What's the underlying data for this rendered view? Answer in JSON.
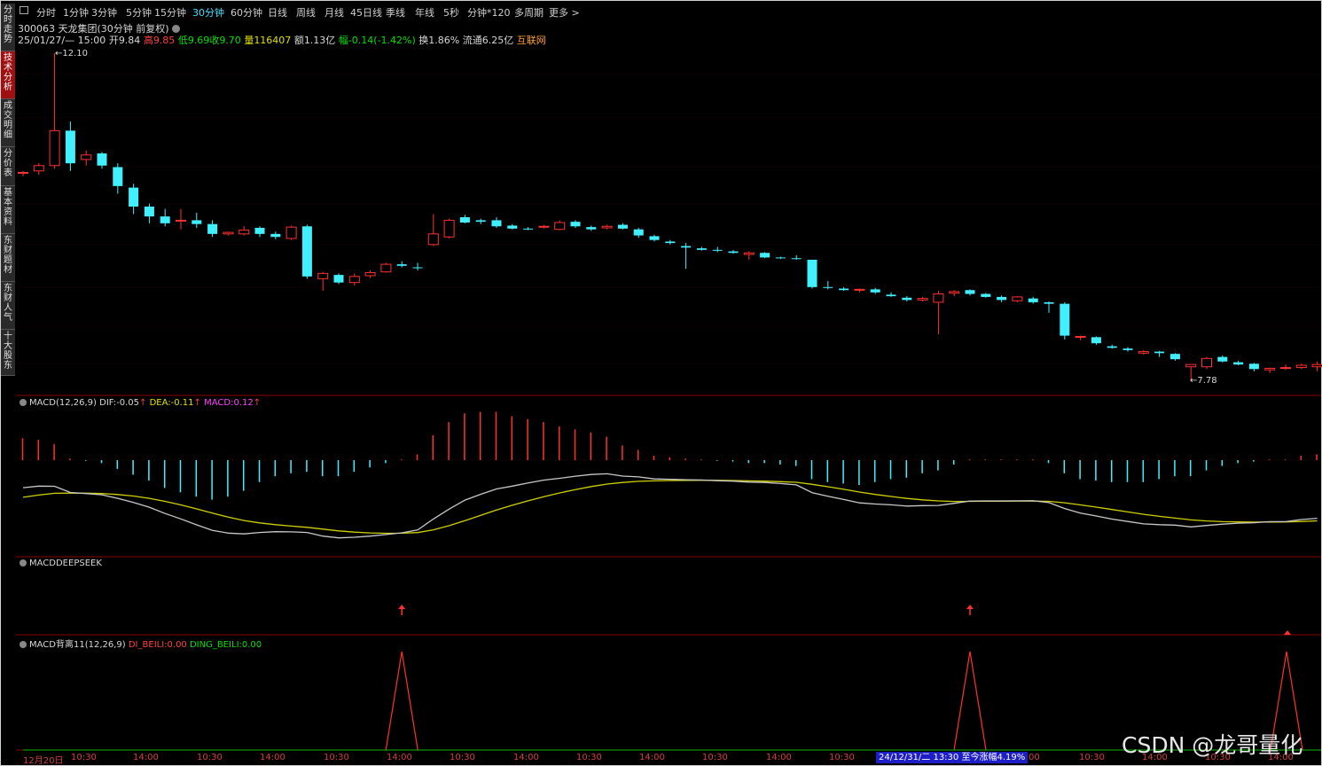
{
  "side_tabs": [
    "分时走势",
    "技术分析",
    "成交明细",
    "分价表",
    "基本资料",
    "东财题材",
    "东财人气",
    "十大股东"
  ],
  "active_side_tab": 1,
  "period_tabs": [
    "分时",
    "1分钟",
    "3分钟",
    "5分钟",
    "15分钟",
    "30分钟",
    "60分钟",
    "日线",
    "周线",
    "月线",
    "45日线",
    "季线",
    "年线",
    "5秒",
    "分钟*120",
    "多周期",
    "更多 >"
  ],
  "active_period_tab": 5,
  "stock": {
    "code_name": "300063 天龙集团",
    "adjust": "(30分钟 前复权)"
  },
  "quote": {
    "datetime": "25/01/27/— 15:00",
    "open_label": "开",
    "open": "9.84",
    "high_label": "高",
    "high": "9.85",
    "low_label": "低",
    "low": "9.69",
    "close_label": "收",
    "close": "9.70",
    "vol_label": "量",
    "vol": "116407",
    "amount_label": "额",
    "amount": "1.13亿",
    "change_label": "幅",
    "change": "-0.14(-1.42%)",
    "turnover_label": "换",
    "turnover": "1.86%",
    "float_label": "流通",
    "float": "6.25亿",
    "concept": "互联网"
  },
  "price_marks": {
    "high": "12.10",
    "low": "7.78"
  },
  "macd_panel": {
    "name": "MACD(12,26,9)",
    "dif_label": "DIF:",
    "dif": "-0.05",
    "dif_arrow": "↑",
    "dea_label": "DEA:",
    "dea": "-0.11",
    "dea_arrow": "↑",
    "macd_label": "MACD:",
    "macd": "0.12",
    "macd_arrow": "↑"
  },
  "deepseek_panel": {
    "name": "MACDDEEPSEEK"
  },
  "beili_panel": {
    "name": "MACD背离11(12,26,9)",
    "di_label": "DI_BEILI:",
    "di": "0.00",
    "ding_label": "DING_BEILI:",
    "ding": "0.00"
  },
  "time_axis": [
    "12月20日",
    "10:30",
    "14:00",
    "10:30",
    "14:00",
    "10:30",
    "14:00",
    "10:30",
    "14:00",
    "10:30",
    "14:00",
    "10:30",
    "14:00",
    "10:30",
    "00",
    "10:30",
    "14:00",
    "10:30",
    "14:00"
  ],
  "cursor_label": "24/12/31/二 13:30  至今涨幅4.19%",
  "watermark": "CSDN @龙哥量化",
  "colors": {
    "up": "#ff3030",
    "down": "#40f0ff",
    "dif": "#c8c8c8",
    "dea": "#d0d000",
    "grid": "#8b0000"
  },
  "chart_data": {
    "type": "candlestick",
    "candles": [
      [
        10.52,
        10.55,
        10.48,
        10.53
      ],
      [
        10.55,
        10.65,
        10.5,
        10.62
      ],
      [
        10.62,
        12.1,
        10.58,
        11.08
      ],
      [
        11.08,
        11.2,
        10.55,
        10.65
      ],
      [
        10.7,
        10.82,
        10.62,
        10.76
      ],
      [
        10.78,
        10.8,
        10.58,
        10.62
      ],
      [
        10.6,
        10.65,
        10.25,
        10.35
      ],
      [
        10.33,
        10.38,
        9.98,
        10.08
      ],
      [
        10.08,
        10.12,
        9.86,
        9.95
      ],
      [
        9.95,
        10.05,
        9.82,
        9.86
      ],
      [
        9.9,
        10.05,
        9.78,
        9.9
      ],
      [
        9.9,
        10.0,
        9.8,
        9.85
      ],
      [
        9.85,
        9.9,
        9.68,
        9.72
      ],
      [
        9.72,
        9.75,
        9.7,
        9.74
      ],
      [
        9.72,
        9.82,
        9.7,
        9.77
      ],
      [
        9.8,
        9.82,
        9.68,
        9.72
      ],
      [
        9.72,
        9.75,
        9.65,
        9.68
      ],
      [
        9.66,
        9.83,
        9.64,
        9.81
      ],
      [
        9.82,
        9.84,
        9.13,
        9.16
      ],
      [
        9.13,
        9.22,
        8.97,
        9.2
      ],
      [
        9.18,
        9.2,
        9.06,
        9.08
      ],
      [
        9.08,
        9.2,
        9.04,
        9.16
      ],
      [
        9.17,
        9.24,
        9.14,
        9.21
      ],
      [
        9.22,
        9.34,
        9.21,
        9.32
      ],
      [
        9.32,
        9.36,
        9.28,
        9.3
      ],
      [
        9.28,
        9.34,
        9.24,
        9.27
      ],
      [
        9.58,
        9.98,
        9.56,
        9.72
      ],
      [
        9.68,
        9.92,
        9.66,
        9.9
      ],
      [
        9.94,
        9.97,
        9.86,
        9.87
      ],
      [
        9.9,
        9.92,
        9.85,
        9.88
      ],
      [
        9.9,
        9.94,
        9.8,
        9.82
      ],
      [
        9.83,
        9.85,
        9.78,
        9.79
      ],
      [
        9.79,
        9.81,
        9.77,
        9.78
      ],
      [
        9.82,
        9.84,
        9.79,
        9.82
      ],
      [
        9.78,
        9.9,
        9.77,
        9.87
      ],
      [
        9.88,
        9.9,
        9.8,
        9.82
      ],
      [
        9.81,
        9.83,
        9.76,
        9.78
      ],
      [
        9.8,
        9.84,
        9.78,
        9.82
      ],
      [
        9.84,
        9.86,
        9.78,
        9.79
      ],
      [
        9.78,
        9.8,
        9.67,
        9.7
      ],
      [
        9.69,
        9.71,
        9.62,
        9.64
      ],
      [
        9.62,
        9.64,
        9.58,
        9.6
      ],
      [
        9.56,
        9.6,
        9.26,
        9.54
      ],
      [
        9.53,
        9.55,
        9.5,
        9.51
      ],
      [
        9.51,
        9.55,
        9.48,
        9.5
      ],
      [
        9.49,
        9.51,
        9.46,
        9.47
      ],
      [
        9.45,
        9.49,
        9.38,
        9.47
      ],
      [
        9.47,
        9.48,
        9.4,
        9.41
      ],
      [
        9.41,
        9.42,
        9.39,
        9.4
      ],
      [
        9.4,
        9.44,
        9.38,
        9.39
      ],
      [
        9.38,
        9.38,
        9.0,
        9.02
      ],
      [
        9.02,
        9.1,
        8.99,
        9.01
      ],
      [
        9.0,
        9.02,
        8.97,
        8.98
      ],
      [
        8.98,
        9.0,
        8.95,
        8.99
      ],
      [
        8.99,
        9.01,
        8.93,
        8.95
      ],
      [
        8.92,
        8.95,
        8.89,
        8.9
      ],
      [
        8.88,
        8.9,
        8.83,
        8.85
      ],
      [
        8.85,
        8.89,
        8.83,
        8.87
      ],
      [
        8.82,
        8.97,
        8.4,
        8.93
      ],
      [
        8.94,
        8.98,
        8.9,
        8.96
      ],
      [
        8.98,
        8.99,
        8.91,
        8.93
      ],
      [
        8.93,
        8.94,
        8.88,
        8.89
      ],
      [
        8.89,
        8.91,
        8.82,
        8.85
      ],
      [
        8.84,
        8.9,
        8.82,
        8.89
      ],
      [
        8.87,
        8.89,
        8.8,
        8.82
      ],
      [
        8.82,
        8.83,
        8.68,
        8.8
      ],
      [
        8.8,
        8.82,
        8.33,
        8.38
      ],
      [
        8.36,
        8.38,
        8.32,
        8.37
      ],
      [
        8.36,
        8.37,
        8.26,
        8.28
      ],
      [
        8.24,
        8.26,
        8.21,
        8.22
      ],
      [
        8.21,
        8.23,
        8.17,
        8.19
      ],
      [
        8.15,
        8.19,
        8.13,
        8.17
      ],
      [
        8.17,
        8.18,
        8.1,
        8.15
      ],
      [
        8.14,
        8.15,
        8.05,
        8.07
      ],
      [
        7.97,
        7.97,
        7.78,
        8.0
      ],
      [
        7.97,
        8.1,
        7.94,
        8.08
      ],
      [
        8.1,
        8.12,
        8.03,
        8.04
      ],
      [
        8.03,
        8.05,
        7.99,
        8.0
      ],
      [
        8.01,
        8.02,
        7.91,
        7.94
      ],
      [
        7.93,
        7.96,
        7.89,
        7.95
      ],
      [
        7.95,
        8.0,
        7.93,
        7.96
      ],
      [
        7.96,
        8.01,
        7.94,
        7.99
      ],
      [
        7.97,
        8.04,
        7.91,
        8.0
      ]
    ],
    "macd_hist": [
      0.15,
      0.14,
      0.11,
      0.01,
      -0.005,
      -0.02,
      -0.06,
      -0.1,
      -0.14,
      -0.19,
      -0.22,
      -0.25,
      -0.27,
      -0.25,
      -0.21,
      -0.15,
      -0.11,
      -0.09,
      -0.08,
      -0.11,
      -0.11,
      -0.08,
      -0.05,
      -0.02,
      0.005,
      0.04,
      0.17,
      0.26,
      0.32,
      0.33,
      0.33,
      0.3,
      0.28,
      0.26,
      0.23,
      0.21,
      0.19,
      0.16,
      0.1,
      0.07,
      0.03,
      0.02,
      0.01,
      0.005,
      -0.005,
      -0.01,
      -0.02,
      -0.02,
      -0.03,
      -0.04,
      -0.13,
      -0.15,
      -0.16,
      -0.17,
      -0.15,
      -0.13,
      -0.12,
      -0.09,
      -0.07,
      -0.03,
      0.005,
      0.005,
      0.005,
      0.005,
      0.005,
      -0.02,
      -0.09,
      -0.13,
      -0.14,
      -0.15,
      -0.15,
      -0.15,
      -0.13,
      -0.11,
      -0.11,
      -0.07,
      -0.04,
      -0.02,
      -0.01,
      0.005,
      0.005,
      0.03,
      0.04
    ],
    "deepseek_signals": [
      24,
      60,
      80
    ],
    "beili_peaks": [
      24,
      60,
      80
    ]
  }
}
